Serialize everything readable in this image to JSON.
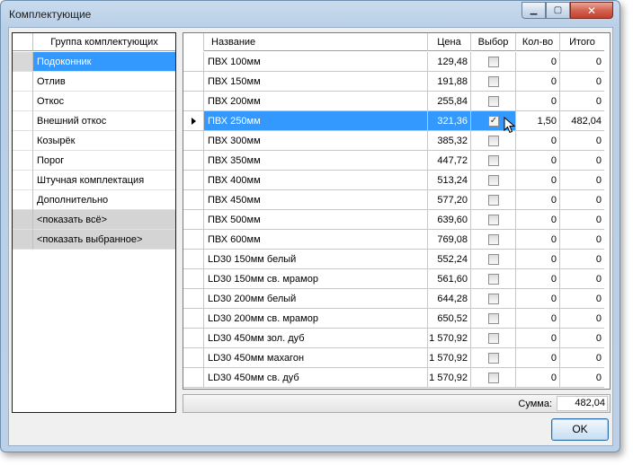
{
  "window": {
    "title": "Комплектующие"
  },
  "titlebar": {
    "minimize_glyph": "▁",
    "maximize_glyph": "▢",
    "close_glyph": "✕"
  },
  "groups": {
    "header": "Группа комплектующих",
    "items": [
      {
        "label": "Подоконник",
        "state": "selected"
      },
      {
        "label": "Отлив",
        "state": "normal"
      },
      {
        "label": "Откос",
        "state": "normal"
      },
      {
        "label": "Внешний откос",
        "state": "normal"
      },
      {
        "label": "Козырёк",
        "state": "normal"
      },
      {
        "label": "Порог",
        "state": "normal"
      },
      {
        "label": "Штучная комплектация",
        "state": "normal"
      },
      {
        "label": "Дополнительно",
        "state": "normal"
      },
      {
        "label": "<показать всё>",
        "state": "gray"
      },
      {
        "label": "<показать выбранное>",
        "state": "gray"
      }
    ]
  },
  "items_table": {
    "headers": {
      "name": "Название",
      "price": "Цена",
      "select": "Выбор",
      "qty": "Кол-во",
      "total": "Итого"
    },
    "rows": [
      {
        "name": "ПВХ 100мм",
        "price": "129,48",
        "checked": false,
        "qty": "0",
        "total": "0"
      },
      {
        "name": "ПВХ 150мм",
        "price": "191,88",
        "checked": false,
        "qty": "0",
        "total": "0"
      },
      {
        "name": "ПВХ 200мм",
        "price": "255,84",
        "checked": false,
        "qty": "0",
        "total": "0"
      },
      {
        "name": "ПВХ 250мм",
        "price": "321,36",
        "checked": true,
        "qty": "1,50",
        "total": "482,04",
        "current": true
      },
      {
        "name": "ПВХ 300мм",
        "price": "385,32",
        "checked": false,
        "qty": "0",
        "total": "0"
      },
      {
        "name": "ПВХ 350мм",
        "price": "447,72",
        "checked": false,
        "qty": "0",
        "total": "0"
      },
      {
        "name": "ПВХ 400мм",
        "price": "513,24",
        "checked": false,
        "qty": "0",
        "total": "0"
      },
      {
        "name": "ПВХ 450мм",
        "price": "577,20",
        "checked": false,
        "qty": "0",
        "total": "0"
      },
      {
        "name": "ПВХ 500мм",
        "price": "639,60",
        "checked": false,
        "qty": "0",
        "total": "0"
      },
      {
        "name": "ПВХ 600мм",
        "price": "769,08",
        "checked": false,
        "qty": "0",
        "total": "0"
      },
      {
        "name": "LD30 150мм белый",
        "price": "552,24",
        "checked": false,
        "qty": "0",
        "total": "0"
      },
      {
        "name": "LD30 150мм св. мрамор",
        "price": "561,60",
        "checked": false,
        "qty": "0",
        "total": "0"
      },
      {
        "name": "LD30 200мм белый",
        "price": "644,28",
        "checked": false,
        "qty": "0",
        "total": "0"
      },
      {
        "name": "LD30 200мм св. мрамор",
        "price": "650,52",
        "checked": false,
        "qty": "0",
        "total": "0"
      },
      {
        "name": "LD30 450мм зол. дуб",
        "price": "1 570,92",
        "checked": false,
        "qty": "0",
        "total": "0"
      },
      {
        "name": "LD30 450мм махагон",
        "price": "1 570,92",
        "checked": false,
        "qty": "0",
        "total": "0"
      },
      {
        "name": "LD30 450мм св. дуб",
        "price": "1 570,92",
        "checked": false,
        "qty": "0",
        "total": "0"
      }
    ]
  },
  "summary": {
    "label": "Сумма:",
    "value": "482,04"
  },
  "ok_button": {
    "label": "OK"
  },
  "colors": {
    "selection": "#3399ff",
    "gray_row": "#d4d4d4",
    "window_frame": "#bcd0e7"
  },
  "icons": {
    "current_row": "row-pointer-icon",
    "check": "checkmark-icon",
    "cursor": "mouse-cursor-icon"
  }
}
